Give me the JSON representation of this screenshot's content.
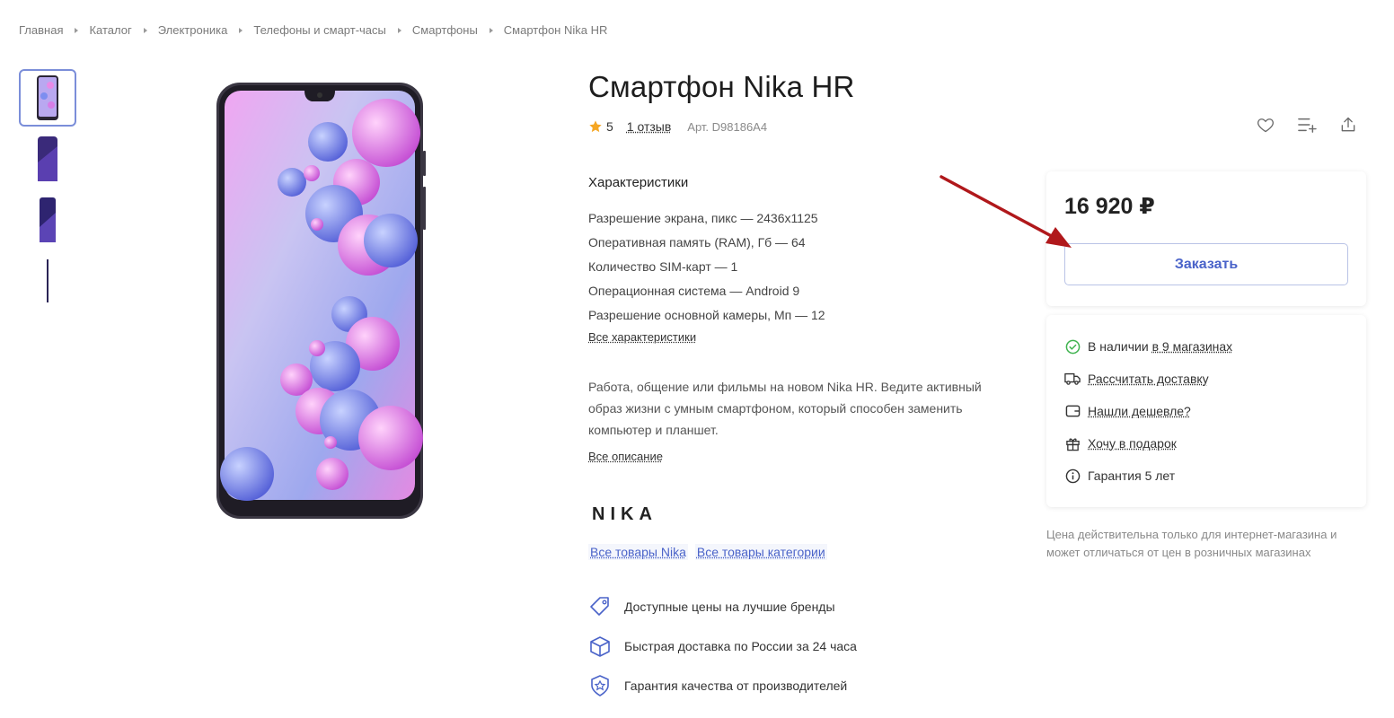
{
  "breadcrumb": [
    "Главная",
    "Каталог",
    "Электроника",
    "Телефоны и смарт-часы",
    "Смартфоны",
    "Смартфон Nika HR"
  ],
  "product": {
    "title": "Смартфон Nika HR",
    "rating": "5",
    "reviews": "1 отзыв",
    "sku": "Арт. D98186A4"
  },
  "specs": {
    "title": "Характеристики",
    "items": [
      "Разрешение экрана, пикс — 2436x1125",
      "Оперативная память (RAM), Гб — 64",
      "Количество SIM-карт — 1",
      "Операционная система — Android 9",
      "Разрешение основной камеры, Мп — 12"
    ],
    "all_link": "Все характеристики"
  },
  "description": {
    "text": "Работа, общение или фильмы на новом Nika HR. Ведите активный образ жизни с умным смартфоном, который способен заменить компьютер и планшет.",
    "all_link": "Все описание"
  },
  "brand": {
    "logo": "NIKA",
    "links": [
      "Все товары Nika",
      "Все товары категории"
    ]
  },
  "features": [
    {
      "icon": "price-tag-icon",
      "text": "Доступные цены на лучшие бренды"
    },
    {
      "icon": "box-icon",
      "text": "Быстрая доставка по России за 24 часа"
    },
    {
      "icon": "quality-badge-icon",
      "text": "Гарантия качества от производителей"
    }
  ],
  "purchase": {
    "price": "16 920 ₽",
    "order_button": "Заказать"
  },
  "availability": {
    "in_stock_prefix": "В наличии",
    "in_stock_link": "в 9 магазинах",
    "delivery": "Рассчитать доставку",
    "cheaper": "Нашли дешевле?",
    "gift": "Хочу в подарок",
    "warranty": "Гарантия 5 лет"
  },
  "note": "Цена действительна только для интернет-магазина и может отличаться от цен в розничных магазинах",
  "colors": {
    "accent": "#4a63c9",
    "star": "#f5a623",
    "in_stock": "#3fb34f",
    "arrow": "#b0181b"
  }
}
